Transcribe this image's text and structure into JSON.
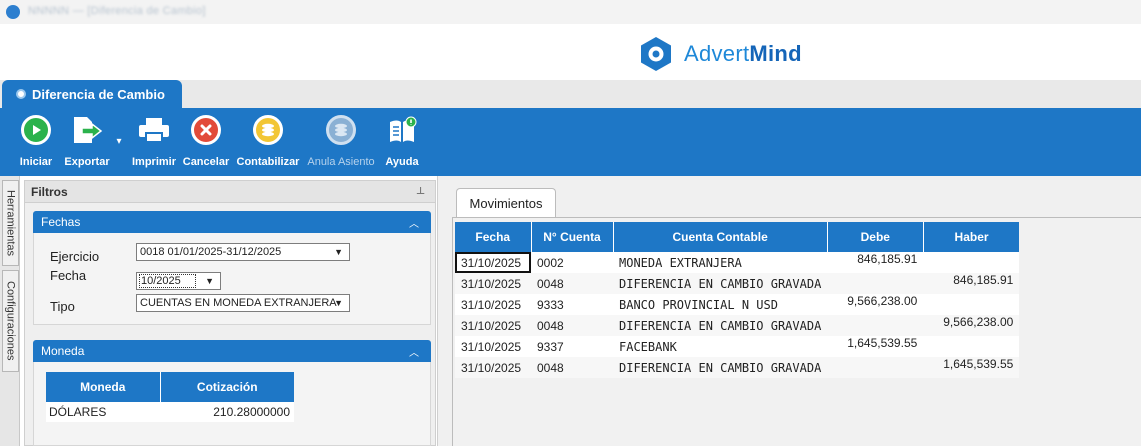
{
  "window": {
    "title": "NNNNN — [Diferencia de Cambio]"
  },
  "brand": {
    "name_light": "Advert",
    "name_bold": "Mind",
    "accent": "#1e77c6"
  },
  "document_tab": {
    "label": "Diferencia de Cambio"
  },
  "toolbar": {
    "buttons": [
      {
        "label": "Iniciar",
        "icon": "play-icon"
      },
      {
        "label": "Exportar",
        "icon": "export-icon"
      },
      {
        "label": "Imprimir",
        "icon": "printer-icon"
      },
      {
        "label": "Cancelar",
        "icon": "cancel-icon"
      },
      {
        "label": "Contabilizar",
        "icon": "coins-icon"
      },
      {
        "label": "Anula Asiento",
        "icon": "undo-entry-icon",
        "enabled": false
      },
      {
        "label": "Ayuda",
        "icon": "help-book-icon"
      }
    ]
  },
  "side_tabs": [
    "Herramientas",
    "Configuraciones"
  ],
  "filters": {
    "title": "Filtros",
    "fechas": {
      "title": "Fechas",
      "ejercicio_label": "Ejercicio",
      "ejercicio_value": "0018 01/01/2025-31/12/2025",
      "fecha_label": "Fecha",
      "fecha_value": "10/2025",
      "tipo_label": "Tipo",
      "tipo_value": "CUENTAS EN MONEDA EXTRANJERA"
    },
    "moneda": {
      "title": "Moneda",
      "columns": [
        "Moneda",
        "Cotización"
      ],
      "rows": [
        {
          "moneda": "DÓLARES",
          "cotizacion": "210.28000000"
        }
      ]
    }
  },
  "movimientos": {
    "tab_label": "Movimientos",
    "columns": [
      "Fecha",
      "N° Cuenta",
      "Cuenta Contable",
      "Debe",
      "Haber"
    ],
    "rows": [
      {
        "fecha": "31/10/2025",
        "cuenta": "0002",
        "contable": "MONEDA EXTRANJERA",
        "debe": "846,185.91",
        "haber": ""
      },
      {
        "fecha": "31/10/2025",
        "cuenta": "0048",
        "contable": "DIFERENCIA EN CAMBIO GRAVADA",
        "debe": "",
        "haber": "846,185.91"
      },
      {
        "fecha": "31/10/2025",
        "cuenta": "9333",
        "contable": "BANCO PROVINCIAL N USD",
        "debe": "9,566,238.00",
        "haber": ""
      },
      {
        "fecha": "31/10/2025",
        "cuenta": "0048",
        "contable": "DIFERENCIA EN CAMBIO GRAVADA",
        "debe": "",
        "haber": "9,566,238.00"
      },
      {
        "fecha": "31/10/2025",
        "cuenta": "9337",
        "contable": "FACEBANK",
        "debe": "1,645,539.55",
        "haber": ""
      },
      {
        "fecha": "31/10/2025",
        "cuenta": "0048",
        "contable": "DIFERENCIA EN CAMBIO GRAVADA",
        "debe": "",
        "haber": "1,645,539.55"
      }
    ]
  }
}
